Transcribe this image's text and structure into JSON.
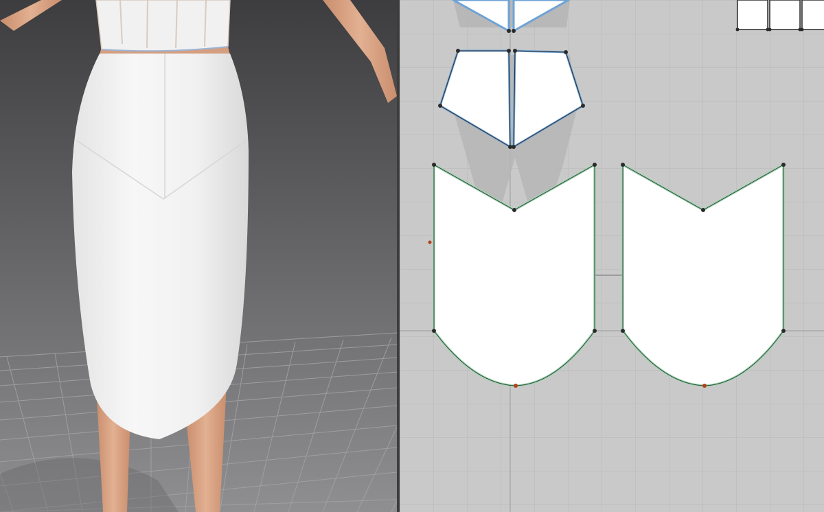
{
  "app": {
    "view_3d_name": "",
    "view_2d_name": ""
  },
  "colors": {
    "viewport_3d_top": "#3e3e40",
    "viewport_3d_bottom": "#8a8a8c",
    "floor_grid": "#9a9a9c",
    "skin": "#d9a585",
    "garment": "#f3f3f3",
    "pattern_bg": "#c9c9c9",
    "pattern_grid": "#b9b9b9",
    "selected_outline": "#6fa3d6",
    "piece_outline": "#a3d4b4",
    "point": "#2b2b2b",
    "curve_point": "#b5401a"
  },
  "scene": {
    "avatar": "avatar-figure",
    "garments": [
      "crop-top",
      "pencil-skirt"
    ]
  },
  "pattern_pieces": [
    {
      "id": "top-front-left",
      "selected": true
    },
    {
      "id": "top-front-right",
      "selected": true
    },
    {
      "id": "top-back-left",
      "selected": true
    },
    {
      "id": "top-back-right",
      "selected": true
    },
    {
      "id": "skirt-front",
      "selected": false
    },
    {
      "id": "skirt-back",
      "selected": false
    },
    {
      "id": "small-rectangles",
      "selected": false
    }
  ]
}
